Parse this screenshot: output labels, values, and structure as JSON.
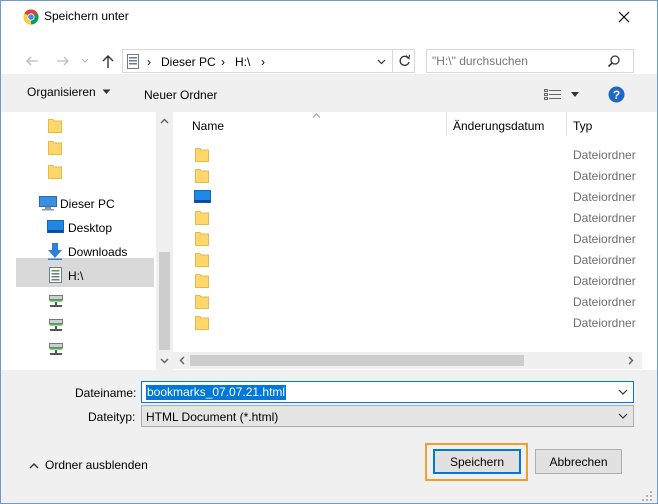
{
  "window": {
    "title": "Speichern unter",
    "close_icon": "close-icon"
  },
  "nav": {
    "breadcrumb": [
      "Dieser PC",
      "H:\\"
    ],
    "search_placeholder": "\"H:\\\" durchsuchen"
  },
  "toolbar": {
    "organize_label": "Organisieren",
    "new_folder_label": "Neuer Ordner"
  },
  "sidebar": {
    "items": [
      {
        "label": "",
        "icon": "folder-icon"
      },
      {
        "label": "",
        "icon": "folder-icon"
      },
      {
        "label": "",
        "icon": "folder-icon"
      },
      {
        "label": "Dieser PC",
        "icon": "computer-icon"
      },
      {
        "label": "Desktop",
        "icon": "desktop-icon"
      },
      {
        "label": "Downloads",
        "icon": "download-icon"
      },
      {
        "label": "H:\\",
        "icon": "drive-icon"
      },
      {
        "label": "",
        "icon": "network-drive-icon"
      },
      {
        "label": "",
        "icon": "network-drive-icon"
      },
      {
        "label": "",
        "icon": "network-drive-icon"
      }
    ]
  },
  "filelist": {
    "columns": {
      "name": "Name",
      "date": "Änderungsdatum",
      "type": "Typ"
    },
    "rows": [
      {
        "icon": "folder-icon",
        "type": "Dateiordner"
      },
      {
        "icon": "folder-icon",
        "type": "Dateiordner"
      },
      {
        "icon": "desktop-icon",
        "type": "Dateiordner"
      },
      {
        "icon": "folder-icon",
        "type": "Dateiordner"
      },
      {
        "icon": "folder-icon",
        "type": "Dateiordner"
      },
      {
        "icon": "folder-icon",
        "type": "Dateiordner"
      },
      {
        "icon": "folder-icon",
        "type": "Dateiordner"
      },
      {
        "icon": "folder-icon",
        "type": "Dateiordner"
      },
      {
        "icon": "folder-icon",
        "type": "Dateiordner"
      }
    ]
  },
  "form": {
    "filename_label": "Dateiname:",
    "filename_value": "bookmarks_07.07.21.html",
    "filetype_label": "Dateityp:",
    "filetype_value": "HTML Document (*.html)"
  },
  "footer": {
    "hide_folders_label": "Ordner ausblenden",
    "save_label": "Speichern",
    "cancel_label": "Abbrechen"
  },
  "colors": {
    "accent": "#0078d7",
    "highlight": "#f0a030",
    "folder": "#ffd76b"
  }
}
